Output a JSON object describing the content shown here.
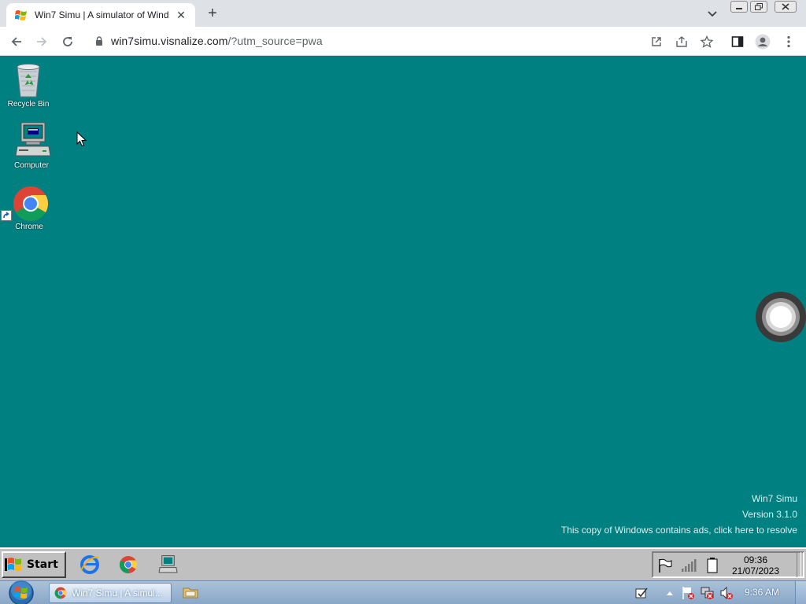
{
  "browser": {
    "tab": {
      "title": "Win7 Simu | A simulator of Wind",
      "close_glyph": "✕"
    },
    "new_tab_glyph": "+",
    "url_host": "win7simu.visnalize.com",
    "url_rest": "/?utm_source=pwa",
    "colors": {
      "tabstrip": "#dee1e6",
      "toolbar": "#ffffff"
    }
  },
  "desktop": {
    "background_color": "#008080",
    "icons": [
      {
        "label": "Recycle Bin",
        "icon": "recycle-bin-icon"
      },
      {
        "label": "Computer",
        "icon": "computer-icon"
      },
      {
        "label": "Chrome",
        "icon": "chrome-icon"
      }
    ],
    "watermark": {
      "name": "Win7 Simu",
      "version": "Version 3.1.0",
      "notice": "This copy of Windows contains ads, click here to resolve"
    }
  },
  "taskbar98": {
    "start_label": "Start",
    "quick_launch": [
      "internet-explorer-icon",
      "chrome-icon",
      "computer-icon"
    ],
    "tray_icons": [
      "flag-icon",
      "signal-bars-icon",
      "battery-icon"
    ],
    "clock_time": "09:36",
    "clock_date": "21/07/2023"
  },
  "taskbar7": {
    "task_label": "Win7 Simu | A simul...",
    "clock": "9:36 AM"
  }
}
